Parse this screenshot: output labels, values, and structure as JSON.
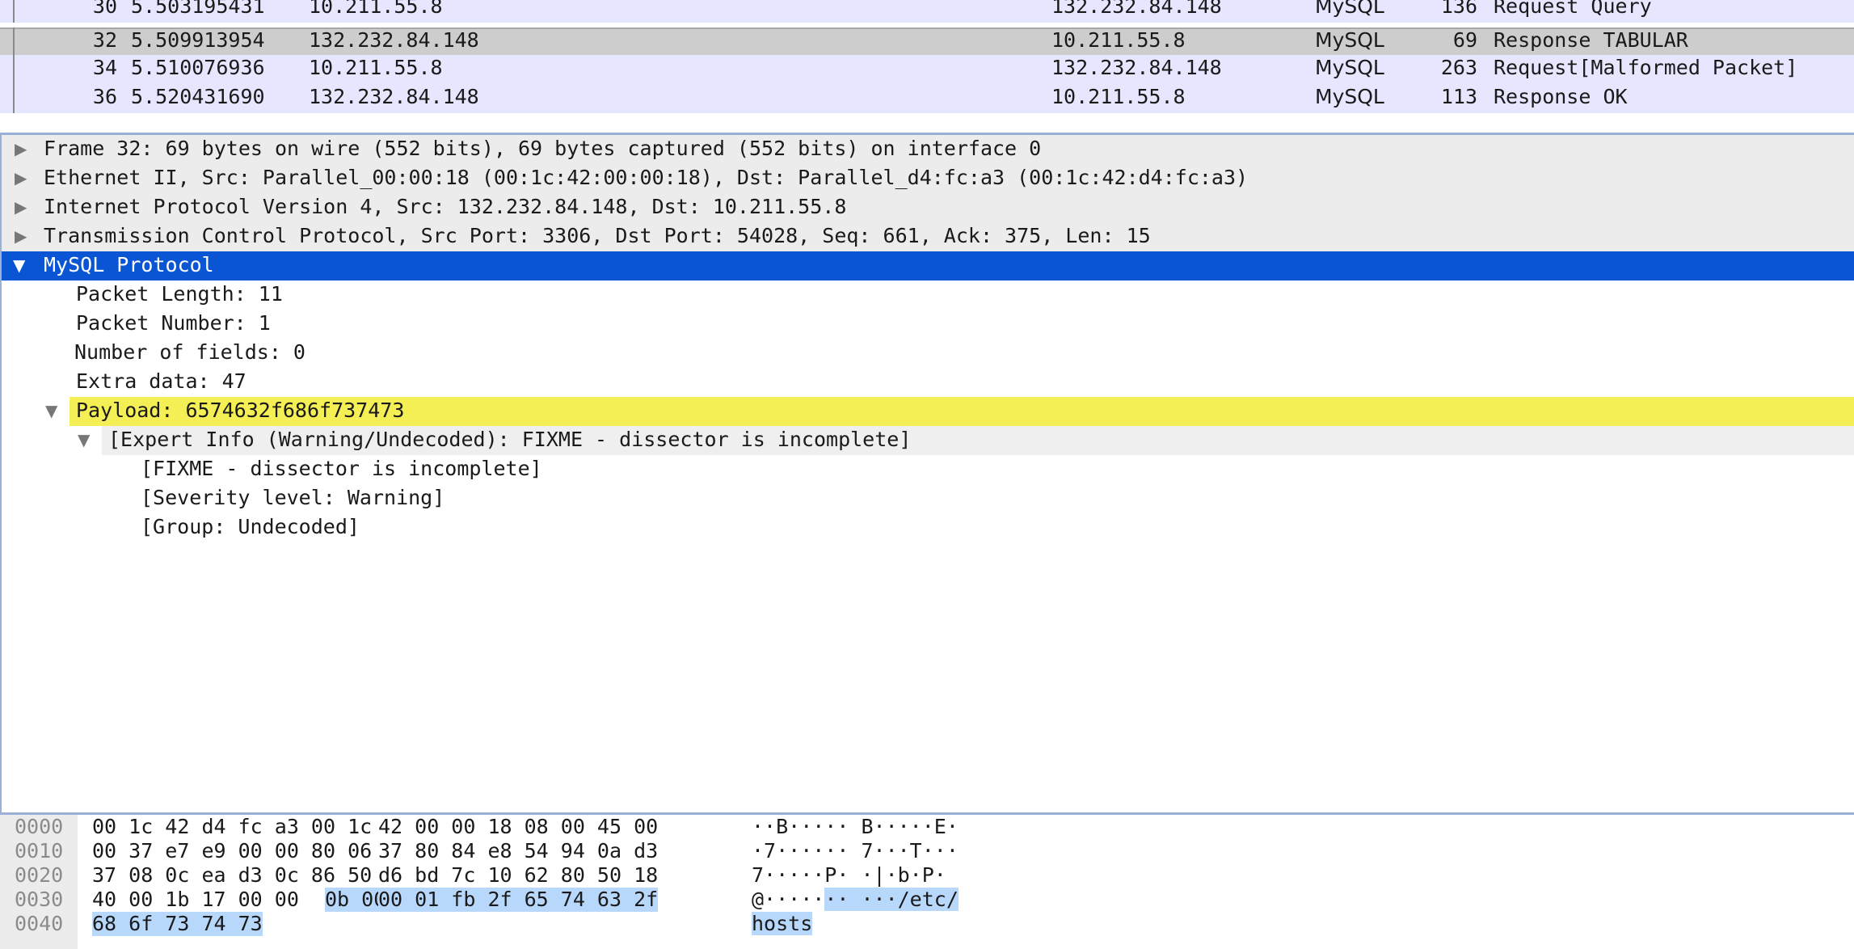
{
  "packet_list": {
    "rows": [
      {
        "no": "30",
        "time": "5.503195431",
        "src": "10.211.55.8",
        "dst": "132.232.84.148",
        "proto": "MySQL",
        "len": "136",
        "info": "Request Query"
      },
      {
        "no": "32",
        "time": "5.509913954",
        "src": "132.232.84.148",
        "dst": "10.211.55.8",
        "proto": "MySQL",
        "len": "69",
        "info": "Response TABULAR"
      },
      {
        "no": "34",
        "time": "5.510076936",
        "src": "10.211.55.8",
        "dst": "132.232.84.148",
        "proto": "MySQL",
        "len": "263",
        "info": "Request[Malformed Packet]"
      },
      {
        "no": "36",
        "time": "5.520431690",
        "src": "132.232.84.148",
        "dst": "10.211.55.8",
        "proto": "MySQL",
        "len": "113",
        "info": "Response OK"
      }
    ],
    "selected_no": "32"
  },
  "details": {
    "frame": "Frame 32: 69 bytes on wire (552 bits), 69 bytes captured (552 bits) on interface 0",
    "ethernet": "Ethernet II, Src: Parallel_00:00:18 (00:1c:42:00:00:18), Dst: Parallel_d4:fc:a3 (00:1c:42:d4:fc:a3)",
    "ip": "Internet Protocol Version 4, Src: 132.232.84.148, Dst: 10.211.55.8",
    "tcp": "Transmission Control Protocol, Src Port: 3306, Dst Port: 54028, Seq: 661, Ack: 375, Len: 15",
    "mysql": "MySQL Protocol",
    "packet_length": "Packet Length: 11",
    "packet_number": "Packet Number: 1",
    "num_fields": "Number of fields: 0",
    "extra_data": "Extra data: 47",
    "payload": "Payload: 6574632f686f737473",
    "expert_info": "[Expert Info (Warning/Undecoded): FIXME - dissector is incomplete]",
    "fixme": "[FIXME - dissector is incomplete]",
    "severity": "[Severity level: Warning]",
    "group": "[Group: Undecoded]",
    "collapsed_arrow": "▶",
    "expanded_arrow": "▼"
  },
  "bytes": {
    "offsets": [
      "0000",
      "0010",
      "0020",
      "0030",
      "0040"
    ],
    "hex_a": [
      "00 1c 42 d4 fc a3 00 1c",
      "00 37 e7 e9 00 00 80 06",
      "37 08 0c ea d3 0c 86 50",
      "40 00 1b 17 00 00 ",
      "68 6f 73 74 73"
    ],
    "hex_a_hl": [
      "",
      "",
      "",
      "0b 00",
      ""
    ],
    "hex_b": [
      "42 00 00 18 08 00 45 00",
      "37 80 84 e8 54 94 0a d3",
      "d6 bd 7c 10 62 80 50 18",
      "",
      ""
    ],
    "hex_b_hl": [
      "",
      "",
      "",
      "00 01 fb 2f 65 74 63 2f",
      ""
    ],
    "ascii_a": [
      "··B····· ",
      "·7······ ",
      "7·····P· ",
      "@·····",
      ""
    ],
    "ascii_a_hl": [
      "",
      "",
      "",
      "··",
      "hosts"
    ],
    "ascii_b": [
      "B·····E·",
      "7···T···",
      "·|·b·P·",
      "",
      ""
    ],
    "ascii_b_hl": [
      "",
      "",
      "",
      " ···/etc/",
      ""
    ]
  },
  "colors": {
    "selected_tree": "#0a55d3",
    "payload_highlight": "#f5ef56",
    "list_bg": "#e7e6ff",
    "byte_highlight": "#b7d7fb"
  }
}
